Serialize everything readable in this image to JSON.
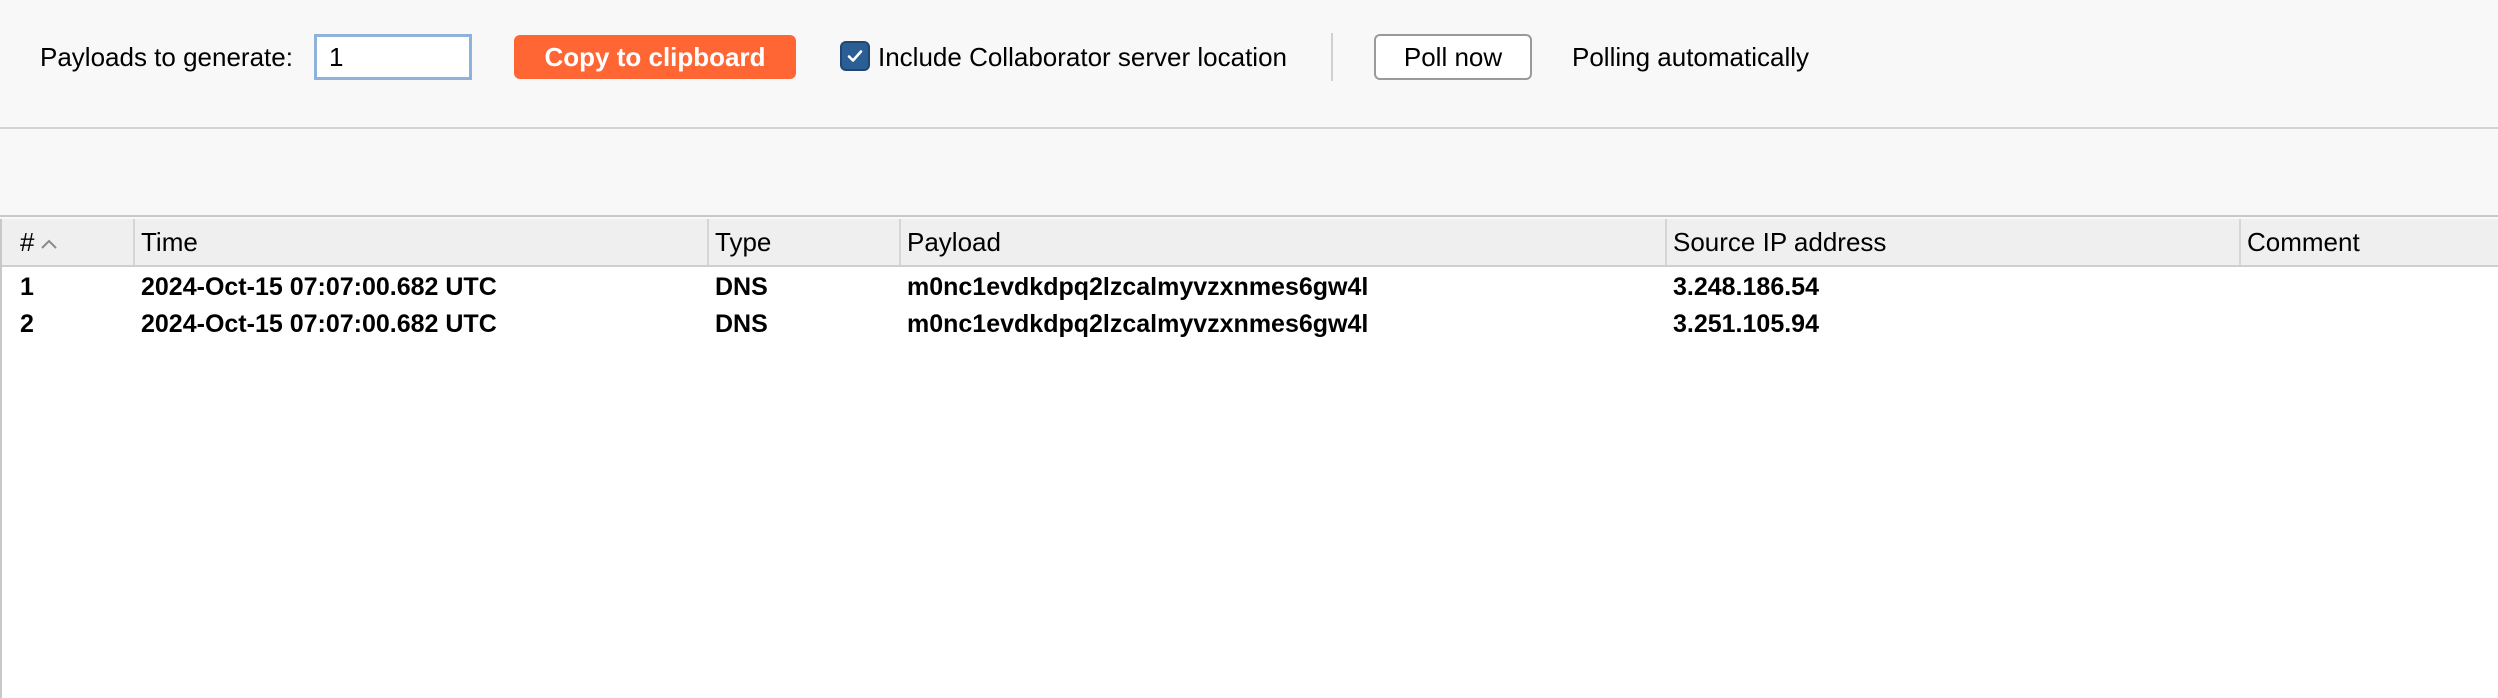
{
  "toolbar": {
    "payloads_label": "Payloads to generate:",
    "payloads_value": "1",
    "copy_button": "Copy to clipboard",
    "include_location_label": "Include Collaborator server location",
    "include_location_checked": true,
    "poll_button": "Poll now",
    "polling_status": "Polling automatically"
  },
  "colors": {
    "accent": "#ff6633",
    "checkbox": "#2c5e96"
  },
  "table": {
    "columns": [
      "#",
      "Time",
      "Type",
      "Payload",
      "Source IP address",
      "Comment"
    ],
    "sort_column": "#",
    "sort_direction": "ascending",
    "rows": [
      {
        "num": "1",
        "time": "2024-Oct-15 07:07:00.682 UTC",
        "type": "DNS",
        "payload": "m0nc1evdkdpq2lzcalmyvzxnmes6gw4l",
        "source_ip": "3.248.186.54",
        "comment": ""
      },
      {
        "num": "2",
        "time": "2024-Oct-15 07:07:00.682 UTC",
        "type": "DNS",
        "payload": "m0nc1evdkdpq2lzcalmyvzxnmes6gw4l",
        "source_ip": "3.251.105.94",
        "comment": ""
      }
    ]
  }
}
